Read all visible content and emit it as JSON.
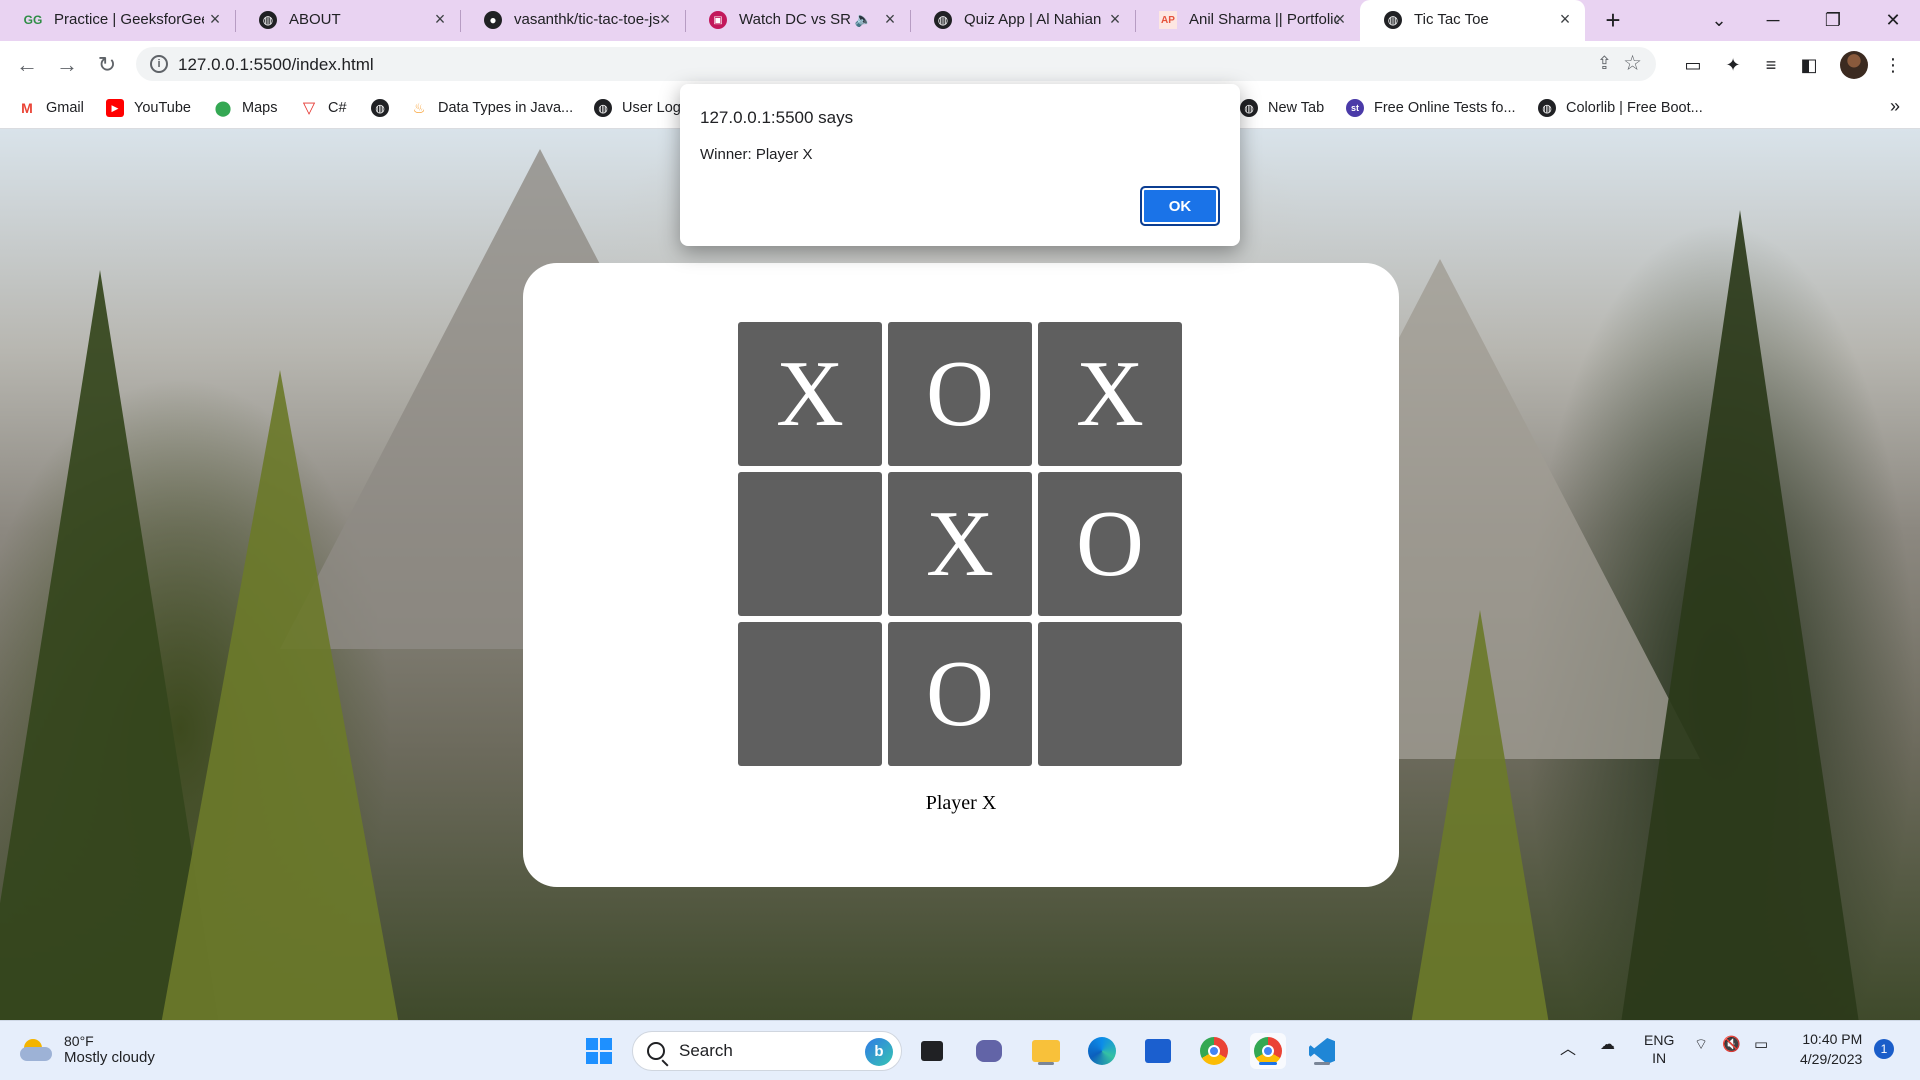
{
  "tabs": [
    {
      "title": "Practice | GeeksforGeeks",
      "favicon": "geeksforgeeks-icon"
    },
    {
      "title": "ABOUT",
      "favicon": "globe-icon"
    },
    {
      "title": "vasanthk/tic-tac-toe-js",
      "favicon": "github-icon"
    },
    {
      "title": "Watch DC vs SRH",
      "favicon": "hotstar-icon",
      "audio": "speaker-icon"
    },
    {
      "title": "Quiz App | Al Nahian",
      "favicon": "globe-icon"
    },
    {
      "title": "Anil Sharma || Portfolio",
      "favicon": "ap-icon"
    },
    {
      "title": "Tic Tac Toe",
      "favicon": "globe-icon",
      "active": true
    }
  ],
  "address_bar": {
    "url": "127.0.0.1:5500/index.html"
  },
  "bookmarks": [
    {
      "label": "Gmail",
      "icon": "gmail-icon"
    },
    {
      "label": "YouTube",
      "icon": "youtube-icon"
    },
    {
      "label": "Maps",
      "icon": "maps-icon"
    },
    {
      "label": "C#",
      "icon": "v-logo-icon"
    },
    {
      "label": "",
      "icon": "globe-icon"
    },
    {
      "label": "Data Types in Java...",
      "icon": "java-icon"
    },
    {
      "label": "User Log",
      "icon": "globe-icon"
    },
    {
      "label": "New Tab",
      "icon": "globe-icon"
    },
    {
      "label": "Free Online Tests fo...",
      "icon": "st-icon"
    },
    {
      "label": "Colorlib | Free Boot...",
      "icon": "globe-icon"
    }
  ],
  "dialog": {
    "origin": "127.0.0.1:5500 says",
    "message": "Winner: Player X",
    "ok_label": "OK"
  },
  "game": {
    "board": [
      "X",
      "O",
      "X",
      "",
      "X",
      "O",
      "",
      "O",
      ""
    ],
    "status": "Player X"
  },
  "taskbar": {
    "weather_temp": "80°F",
    "weather_desc": "Mostly cloudy",
    "search_label": "Search",
    "lang_top": "ENG",
    "lang_bottom": "IN",
    "time": "10:40 PM",
    "date": "4/29/2023",
    "notifications": "1"
  },
  "colors": {
    "tab_strip": "#e9d3f2",
    "cell": "#5f5f5f",
    "accent": "#1a73e8"
  }
}
